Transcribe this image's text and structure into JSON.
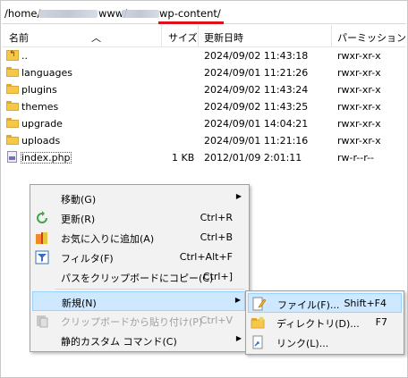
{
  "path": {
    "prefix": "/home/",
    "mid": "www/",
    "current": "wp-content/"
  },
  "columns": {
    "name": "名前",
    "size": "サイズ",
    "modified": "更新日時",
    "permissions": "パーミッション"
  },
  "files": [
    {
      "name": "..",
      "size": "",
      "modified": "2024/09/02 11:43:18",
      "perm": "rwxr-xr-x",
      "type": "up"
    },
    {
      "name": "languages",
      "size": "",
      "modified": "2024/09/01 11:21:26",
      "perm": "rwxr-xr-x",
      "type": "folder"
    },
    {
      "name": "plugins",
      "size": "",
      "modified": "2024/09/02 11:43:24",
      "perm": "rwxr-xr-x",
      "type": "folder"
    },
    {
      "name": "themes",
      "size": "",
      "modified": "2024/09/02 11:43:25",
      "perm": "rwxr-xr-x",
      "type": "folder"
    },
    {
      "name": "upgrade",
      "size": "",
      "modified": "2024/09/01 14:04:21",
      "perm": "rwxr-xr-x",
      "type": "folder"
    },
    {
      "name": "uploads",
      "size": "",
      "modified": "2024/09/01 11:21:16",
      "perm": "rwxr-xr-x",
      "type": "folder"
    },
    {
      "name": "index.php",
      "size": "1 KB",
      "modified": "2012/01/09 2:01:11",
      "perm": "rw-r--r--",
      "type": "file"
    }
  ],
  "context_menu": [
    {
      "label": "移動(G)",
      "shortcut": "",
      "submenu": true,
      "icon": "none"
    },
    {
      "label": "更新(R)",
      "shortcut": "Ctrl+R",
      "submenu": false,
      "icon": "refresh-icon"
    },
    {
      "label": "お気に入りに追加(A)",
      "shortcut": "Ctrl+B",
      "submenu": false,
      "icon": "bookmark-icon"
    },
    {
      "label": "フィルタ(F)",
      "shortcut": "Ctrl+Alt+F",
      "submenu": false,
      "icon": "filter-icon"
    },
    {
      "label": "パスをクリップボードにコピー(C)",
      "shortcut": "Ctrl+]",
      "submenu": false,
      "icon": "none"
    },
    {
      "label": "新規(N)",
      "shortcut": "",
      "submenu": true,
      "icon": "none",
      "highlighted": true
    },
    {
      "label": "クリップボードから貼り付け(P)",
      "shortcut": "Ctrl+V",
      "submenu": false,
      "icon": "paste-icon",
      "disabled": true
    },
    {
      "label": "静的カスタム コマンド(C)",
      "shortcut": "",
      "submenu": true,
      "icon": "none"
    }
  ],
  "submenu": [
    {
      "label": "ファイル(F)...",
      "shortcut": "Shift+F4",
      "icon": "new-file-icon",
      "highlighted": true
    },
    {
      "label": "ディレクトリ(D)...",
      "shortcut": "F7",
      "icon": "new-folder-icon"
    },
    {
      "label": "リンク(L)...",
      "shortcut": "",
      "icon": "link-icon"
    }
  ],
  "colors": {
    "highlight_bg": "#cde8ff",
    "highlight_border": "#99d1ff",
    "underline_red": "#e0101a",
    "folder_yellow": "#f6c84a"
  }
}
